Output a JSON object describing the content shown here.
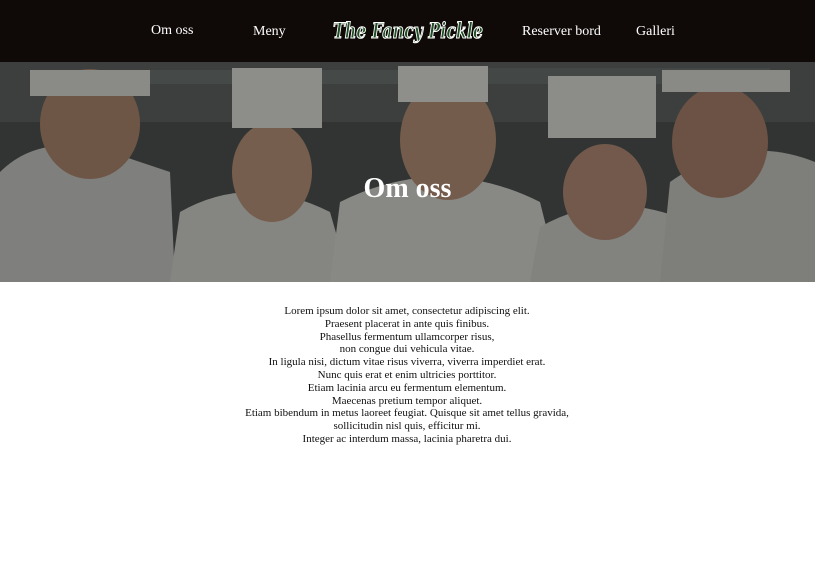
{
  "nav": {
    "items": [
      {
        "label": "Om oss"
      },
      {
        "label": "Meny"
      },
      {
        "label": "Reserver bord"
      },
      {
        "label": "Galleri"
      }
    ],
    "logo_text": "The Fancy Pickle",
    "background": "#0f0a08",
    "logo_color": "#1f4d24",
    "logo_outline": "#ffffff"
  },
  "hero": {
    "title": "Om oss",
    "image": "five-smiling-chefs-photo"
  },
  "content": {
    "lines": [
      "Lorem ipsum dolor sit amet, consectetur adipiscing elit.",
      "Praesent placerat in ante quis finibus.",
      "Phasellus fermentum ullamcorper risus,",
      "non congue dui vehicula vitae.",
      "In ligula nisi, dictum vitae risus viverra, viverra imperdiet erat.",
      "Nunc quis erat et enim ultricies porttitor.",
      "Etiam lacinia arcu eu fermentum elementum.",
      "Maecenas pretium tempor aliquet.",
      "Etiam bibendum in metus laoreet feugiat. Quisque sit amet tellus gravida,",
      "sollicitudin nisl quis, efficitur mi.",
      "Integer ac interdum massa, lacinia pharetra dui."
    ]
  }
}
